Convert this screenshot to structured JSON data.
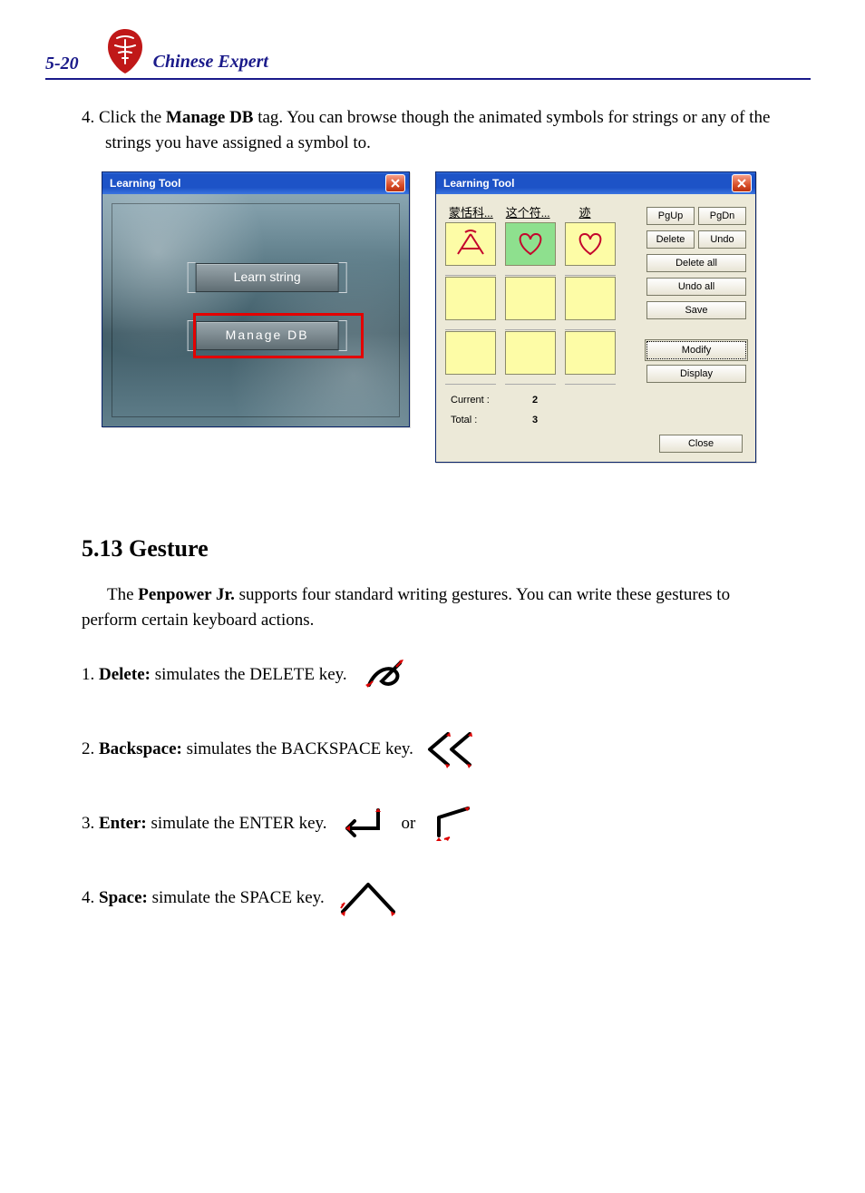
{
  "header": {
    "page_number": "5-20",
    "book_title": "Chinese Expert"
  },
  "step4": {
    "prefix": "4. Click the ",
    "bold": "Manage DB",
    "rest": " tag. You can browse though the animated symbols for strings or any of the strings you have assigned a symbol to."
  },
  "win_left": {
    "title": "Learning Tool",
    "learn_btn": "Learn string",
    "manage_btn": "Manage DB"
  },
  "win_right": {
    "title": "Learning Tool",
    "col_labels": [
      "蒙恬科...",
      "这个符...",
      "迹"
    ],
    "side": {
      "pgup": "PgUp",
      "pgdn": "PgDn",
      "delete": "Delete",
      "undo": "Undo",
      "delete_all": "Delete all",
      "undo_all": "Undo all",
      "save": "Save",
      "modify": "Modify",
      "display": "Display"
    },
    "current_label": "Current :",
    "current_value": "2",
    "total_label": "Total :",
    "total_value": "3",
    "close": "Close"
  },
  "section": {
    "heading": "5.13  Gesture",
    "intro_pre": "The ",
    "intro_bold": "Penpower Jr.",
    "intro_post": " supports four standard writing gestures. You can write these gestures to perform certain keyboard actions.",
    "items": [
      {
        "num": "1. ",
        "bold": "Delete:",
        "rest": " simulates the DELETE key."
      },
      {
        "num": "2. ",
        "bold": "Backspace:",
        "rest": " simulates the BACKSPACE key."
      },
      {
        "num": "3. ",
        "bold": "Enter:",
        "rest": " simulate the ENTER key.",
        "or": "or"
      },
      {
        "num": "4. ",
        "bold": "Space:",
        "rest": " simulate the SPACE key."
      }
    ]
  }
}
